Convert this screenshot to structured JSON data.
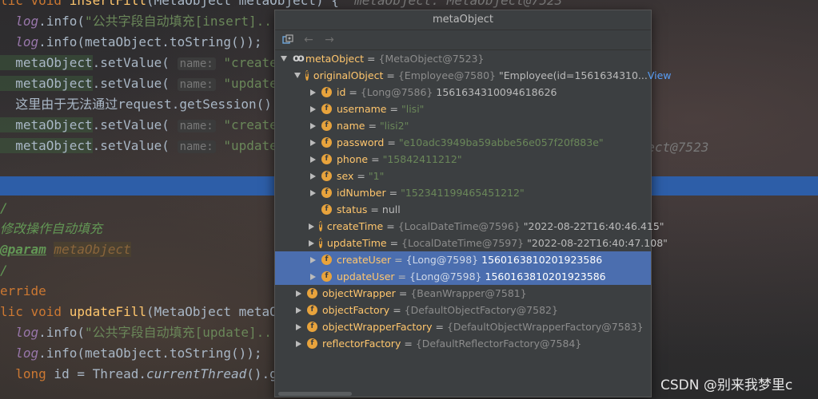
{
  "editor": {
    "lines": [
      {
        "segments": [
          {
            "t": "lic void ",
            "c": "kw"
          },
          {
            "t": "insertFill",
            "c": "fn"
          },
          {
            "t": "(MetaObject metaObject) {  ",
            "c": ""
          },
          {
            "t": "metaObject: MetaObject@7523",
            "c": "hint-plain"
          }
        ]
      },
      {
        "segments": [
          {
            "t": "  log",
            "c": "static gray"
          },
          {
            "t": ".info(",
            "c": ""
          },
          {
            "t": "\"公共字段自动填充[insert]...\"",
            "c": "str"
          }
        ]
      },
      {
        "segments": [
          {
            "t": "  log",
            "c": "static gray"
          },
          {
            "t": ".info(metaObject.toString());",
            "c": ""
          }
        ]
      },
      {
        "segments": [
          {
            "t": "  metaObject",
            "c": "green-bg"
          },
          {
            "t": ".setValue( ",
            "c": ""
          },
          {
            "t": "name:",
            "c": "hint"
          },
          {
            "t": " \"createTim",
            "c": "str"
          }
        ]
      },
      {
        "segments": [
          {
            "t": "  metaObject",
            "c": "green-bg"
          },
          {
            "t": ".setValue( ",
            "c": ""
          },
          {
            "t": "name:",
            "c": "hint"
          },
          {
            "t": " \"updateTim",
            "c": "str"
          }
        ]
      },
      {
        "segments": [
          {
            "t": "  这里由于无法通过request.getSession().g",
            "c": ""
          }
        ]
      },
      {
        "segments": [
          {
            "t": "  metaObject",
            "c": "green-bg"
          },
          {
            "t": ".setValue( ",
            "c": ""
          },
          {
            "t": "name:",
            "c": "hint"
          },
          {
            "t": " \"createUse",
            "c": "str"
          }
        ]
      },
      {
        "segments": [
          {
            "t": "  metaObject",
            "c": "green-bg"
          },
          {
            "t": ".setValue( ",
            "c": ""
          },
          {
            "t": "name:",
            "c": "hint"
          },
          {
            "t": " \"updateUse",
            "c": "str"
          }
        ]
      },
      {
        "segments": [
          {
            "t": "",
            "c": ""
          }
        ]
      },
      {
        "segments": [
          {
            "t": "",
            "c": ""
          }
        ]
      },
      {
        "segments": [
          {
            "t": "/",
            "c": "cmt"
          }
        ]
      },
      {
        "segments": [
          {
            "t": "修改操作自动填充",
            "c": "cmt"
          }
        ]
      },
      {
        "segments": [
          {
            "t": "@param",
            "c": "param"
          },
          {
            "t": " ",
            "c": ""
          },
          {
            "t": "metaObject",
            "c": "paramval"
          }
        ]
      },
      {
        "segments": [
          {
            "t": "/",
            "c": "cmt"
          }
        ]
      },
      {
        "segments": [
          {
            "t": "erride",
            "c": "kw"
          }
        ]
      },
      {
        "segments": [
          {
            "t": "lic void ",
            "c": "kw"
          },
          {
            "t": "updateFill",
            "c": "fn"
          },
          {
            "t": "(MetaObject metaOb",
            "c": ""
          }
        ]
      },
      {
        "segments": [
          {
            "t": "  log",
            "c": "static gray"
          },
          {
            "t": ".info(",
            "c": ""
          },
          {
            "t": "\"公共字段自动填充[update]...\"",
            "c": "str"
          }
        ]
      },
      {
        "segments": [
          {
            "t": "  log",
            "c": "static gray"
          },
          {
            "t": ".info(metaObject.toString());",
            "c": ""
          }
        ]
      },
      {
        "segments": [
          {
            "t": "  long",
            "c": "kw"
          },
          {
            "t": " id = Thread.",
            "c": ""
          },
          {
            "t": "currentThread",
            "c": "static"
          },
          {
            "t": "().getId",
            "c": ""
          }
        ]
      }
    ],
    "right_hint": "bject@7523"
  },
  "popup": {
    "title": "metaObject",
    "toolbar": [
      "restore-icon",
      "back-arrow-icon",
      "forward-arrow-icon"
    ],
    "rows": [
      {
        "level": 0,
        "arrow": "down",
        "icon": "oo",
        "name": "metaObject",
        "type": "{MetaObject@7523}",
        "value": "",
        "vclass": "",
        "sel": false
      },
      {
        "level": 1,
        "arrow": "down",
        "icon": "f",
        "name": "originalObject",
        "type": "{Employee@7580}",
        "value": "\"Employee(id=1561634310...",
        "vclass": "plain",
        "view": "View",
        "sel": false
      },
      {
        "level": 2,
        "arrow": "right",
        "icon": "f",
        "name": "id",
        "type": "{Long@7586}",
        "value": "1561634310094618626",
        "vclass": "num",
        "sel": false
      },
      {
        "level": 2,
        "arrow": "right",
        "icon": "f",
        "name": "username",
        "type": "",
        "value": "\"lisi\"",
        "vclass": "str",
        "sel": false
      },
      {
        "level": 2,
        "arrow": "right",
        "icon": "f",
        "name": "name",
        "type": "",
        "value": "\"lisi2\"",
        "vclass": "str",
        "sel": false
      },
      {
        "level": 2,
        "arrow": "right",
        "icon": "f",
        "name": "password",
        "type": "",
        "value": "\"e10adc3949ba59abbe56e057f20f883e\"",
        "vclass": "str",
        "sel": false
      },
      {
        "level": 2,
        "arrow": "right",
        "icon": "f",
        "name": "phone",
        "type": "",
        "value": "\"15842411212\"",
        "vclass": "str",
        "sel": false
      },
      {
        "level": 2,
        "arrow": "right",
        "icon": "f",
        "name": "sex",
        "type": "",
        "value": "\"1\"",
        "vclass": "str",
        "sel": false
      },
      {
        "level": 2,
        "arrow": "right",
        "icon": "f",
        "name": "idNumber",
        "type": "",
        "value": "\"152341199465451212\"",
        "vclass": "str",
        "sel": false
      },
      {
        "level": 2,
        "arrow": "none",
        "icon": "f",
        "name": "status",
        "type": "",
        "value": "null",
        "vclass": "plain",
        "sel": false
      },
      {
        "level": 2,
        "arrow": "right",
        "icon": "f",
        "name": "createTime",
        "type": "{LocalDateTime@7596}",
        "value": "\"2022-08-22T16:40:46.415\"",
        "vclass": "plain",
        "sel": false
      },
      {
        "level": 2,
        "arrow": "right",
        "icon": "f",
        "name": "updateTime",
        "type": "{LocalDateTime@7597}",
        "value": "\"2022-08-22T16:40:47.108\"",
        "vclass": "plain",
        "sel": false
      },
      {
        "level": 2,
        "arrow": "right",
        "icon": "f",
        "name": "createUser",
        "type": "{Long@7598}",
        "value": "1560163810201923586",
        "vclass": "num",
        "sel": true
      },
      {
        "level": 2,
        "arrow": "right",
        "icon": "f",
        "name": "updateUser",
        "type": "{Long@7598}",
        "value": "1560163810201923586",
        "vclass": "num",
        "sel": true
      },
      {
        "level": 1,
        "arrow": "right",
        "icon": "f",
        "name": "objectWrapper",
        "type": "{BeanWrapper@7581}",
        "value": "",
        "vclass": "",
        "sel": false
      },
      {
        "level": 1,
        "arrow": "right",
        "icon": "f",
        "name": "objectFactory",
        "type": "{DefaultObjectFactory@7582}",
        "value": "",
        "vclass": "",
        "sel": false
      },
      {
        "level": 1,
        "arrow": "right",
        "icon": "f",
        "name": "objectWrapperFactory",
        "type": "{DefaultObjectWrapperFactory@7583}",
        "value": "",
        "vclass": "",
        "sel": false
      },
      {
        "level": 1,
        "arrow": "right",
        "icon": "f",
        "name": "reflectorFactory",
        "type": "{DefaultReflectorFactory@7584}",
        "value": "",
        "vclass": "",
        "sel": false
      }
    ]
  },
  "watermark": "CSDN @别来我梦里c"
}
